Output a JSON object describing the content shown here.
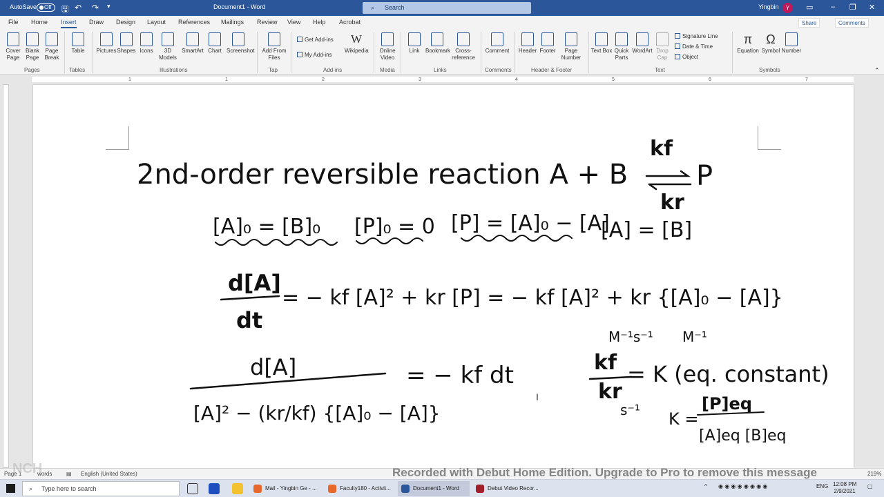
{
  "titlebar": {
    "autosave_label": "AutoSave",
    "autosave_state": "Off",
    "doc_title": "Document1 - Word",
    "search_placeholder": "Search",
    "user_name": "Yingbin",
    "user_initial": "Y"
  },
  "tabs": [
    "File",
    "Home",
    "Insert",
    "Draw",
    "Design",
    "Layout",
    "References",
    "Mailings",
    "Review",
    "View",
    "Help",
    "Acrobat"
  ],
  "active_tab": "Insert",
  "share_label": "Share",
  "comments_label": "Comments",
  "ribbon": {
    "pages": {
      "group": "Pages",
      "items": [
        "Cover Page",
        "Blank Page",
        "Page Break"
      ]
    },
    "tables": {
      "group": "Tables",
      "items": [
        "Table"
      ]
    },
    "illustrations": {
      "group": "Illustrations",
      "items": [
        "Pictures",
        "Shapes",
        "Icons",
        "3D Models",
        "SmartArt",
        "Chart",
        "Screenshot"
      ]
    },
    "tap": {
      "group": "Tap",
      "items": [
        "Add From Files"
      ]
    },
    "addins": {
      "group": "Add-ins",
      "items": [
        "Get Add-ins",
        "My Add-ins",
        "Wikipedia"
      ]
    },
    "media": {
      "group": "Media",
      "items": [
        "Online Video"
      ]
    },
    "links": {
      "group": "Links",
      "items": [
        "Link",
        "Bookmark",
        "Cross-reference"
      ]
    },
    "comments": {
      "group": "Comments",
      "items": [
        "Comment"
      ]
    },
    "headerfooter": {
      "group": "Header & Footer",
      "items": [
        "Header",
        "Footer",
        "Page Number"
      ]
    },
    "text": {
      "group": "Text",
      "items": [
        "Text Box",
        "Quick Parts",
        "WordArt",
        "Drop Cap",
        "Signature Line",
        "Date & Time",
        "Object"
      ]
    },
    "symbols": {
      "group": "Symbols",
      "items": [
        "Equation",
        "Symbol",
        "Number"
      ]
    }
  },
  "ruler_ticks": [
    "1",
    "1",
    "2",
    "3",
    "4",
    "5",
    "6",
    "7"
  ],
  "handwriting": {
    "title": "2nd-order reversible reaction  A + B",
    "kf": "kf",
    "kr": "kr",
    "product": "P",
    "conditions": [
      "[A]₀ = [B]₀",
      "[P]₀ = 0",
      "[P] = [A]₀ − [A]",
      "[A] = [B]"
    ],
    "rate_eq_lhs_num": "d[A]",
    "rate_eq_lhs_den": "dt",
    "rate_eq_rhs": "= − kf [A]² + kr [P] = − kf [A]² + kr {[A]₀ − [A]}",
    "sep_num": "d[A]",
    "sep_den": "[A]² − (kr/kf) {[A]₀ − [A]}",
    "sep_rhs": "= − kf dt",
    "units_top": "M⁻¹s⁻¹",
    "units_bottom": "s⁻¹",
    "keq_units": "M⁻¹",
    "keq_text": "= K (eq. constant)",
    "keq_def_lhs": "K =",
    "keq_def_num": "[P]eq",
    "keq_def_den": "[A]eq [B]eq"
  },
  "status": {
    "page": "Page 1",
    "words": "words",
    "language": "English (United States)",
    "zoom": "219%"
  },
  "watermark": "Recorded with Debut Home Edition. Upgrade to Pro to remove this message",
  "taskbar": {
    "search_placeholder": "Type here to search",
    "apps": [
      "Mail - Yingbin Ge - ...",
      "Faculty180 - Activit...",
      "Document1 - Word",
      "Debut Video Recor..."
    ],
    "lang": "ENG",
    "time": "12:08 PM",
    "date": "2/9/2021"
  },
  "colors": {
    "word_blue": "#2b579a",
    "ink": "#111111"
  }
}
